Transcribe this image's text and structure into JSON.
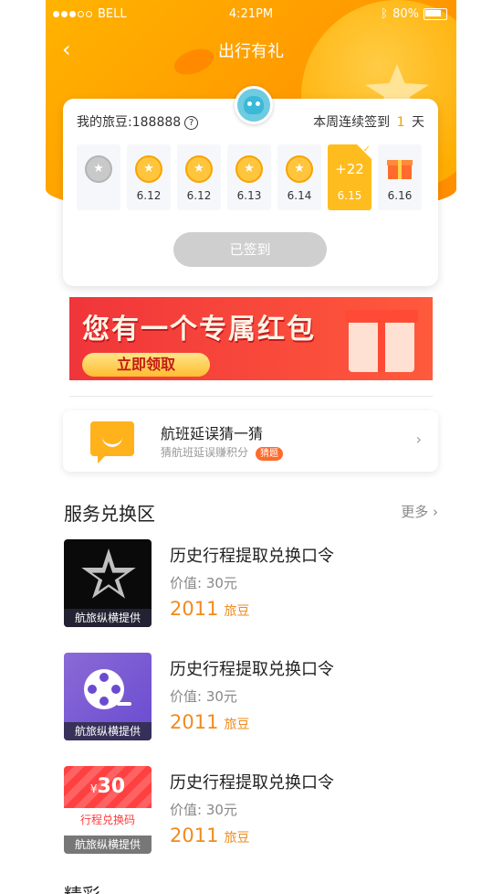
{
  "status_bar": {
    "carrier": "BELL",
    "time": "4:21PM",
    "battery": "80%"
  },
  "nav": {
    "title": "出行有礼",
    "back_icon": "chevron-left-icon"
  },
  "checkin": {
    "beans_label": "我的旅豆:188888",
    "streak_prefix": "本周连续签到",
    "streak_days": "1",
    "streak_suffix": "天",
    "days": [
      {
        "label": "",
        "state": "missed"
      },
      {
        "label": "6.12",
        "state": "coin"
      },
      {
        "label": "6.12",
        "state": "coin"
      },
      {
        "label": "6.13",
        "state": "coin"
      },
      {
        "label": "6.14",
        "state": "coin"
      },
      {
        "label": "6.15",
        "state": "today",
        "reward": "+22"
      },
      {
        "label": "6.16",
        "state": "gift"
      }
    ],
    "button_label": "已签到"
  },
  "banner": {
    "title": "您有一个专属红包",
    "button": "立即领取"
  },
  "guess": {
    "title": "航班延误猜一猜",
    "subtitle": "猜航班延误赚积分",
    "tag": "猜题"
  },
  "services": {
    "title": "服务兑换区",
    "more": "更多",
    "items": [
      {
        "title": "历史行程提取兑换口令",
        "value": "价值: 30元",
        "price": "2011",
        "unit": "旅豆",
        "caption": "航旅纵横提供"
      },
      {
        "title": "历史行程提取兑换口令",
        "value": "价值: 30元",
        "price": "2011",
        "unit": "旅豆",
        "caption": "航旅纵横提供"
      },
      {
        "title": "历史行程提取兑换口令",
        "value": "价值: 30元",
        "price": "2011",
        "unit": "旅豆",
        "caption": "航旅纵横提供",
        "coupon_amount": "30",
        "coupon_currency": "¥",
        "coupon_sub": "行程兑换码"
      }
    ]
  },
  "next_section": "精彩",
  "colors": {
    "primary": "#ffb300",
    "accent": "#f08b1c",
    "tag": "#ff6a2a"
  }
}
